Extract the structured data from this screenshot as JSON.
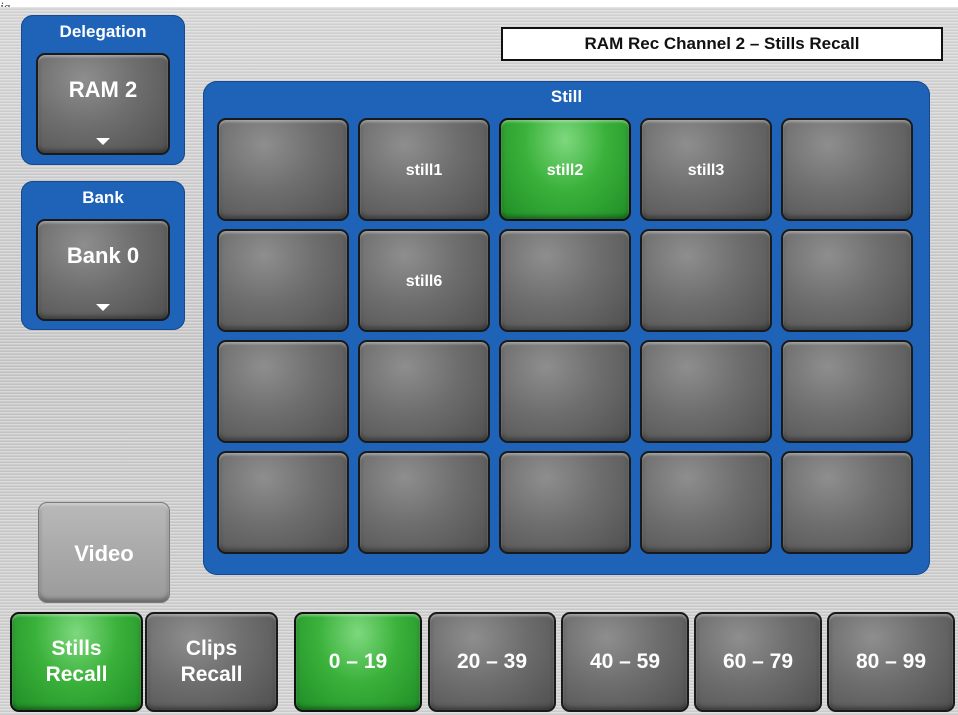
{
  "figure_label": "ig",
  "title": "RAM Rec Channel 2 – Stills Recall",
  "delegation": {
    "title": "Delegation",
    "value": "RAM 2"
  },
  "bank": {
    "title": "Bank",
    "value": "Bank 0"
  },
  "still_panel": {
    "title": "Still",
    "cells": [
      "",
      "still1",
      "still2",
      "still3",
      "",
      "",
      "still6",
      "",
      "",
      "",
      "",
      "",
      "",
      "",
      "",
      "",
      "",
      "",
      "",
      ""
    ],
    "selected_index": 2
  },
  "video_button": "Video",
  "mode_buttons": {
    "stills": "Stills\nRecall",
    "clips": "Clips\nRecall",
    "active": "stills"
  },
  "range_buttons": [
    "0 – 19",
    "20 – 39",
    "40 – 59",
    "60 – 79",
    "80 – 99"
  ],
  "active_range_index": 0,
  "colors": {
    "panel_blue": "#1e63b8",
    "active_green": "#3bb23b",
    "button_gray": "#6e6e6e"
  },
  "icons": {
    "dropdown": "triangle-down-icon"
  }
}
